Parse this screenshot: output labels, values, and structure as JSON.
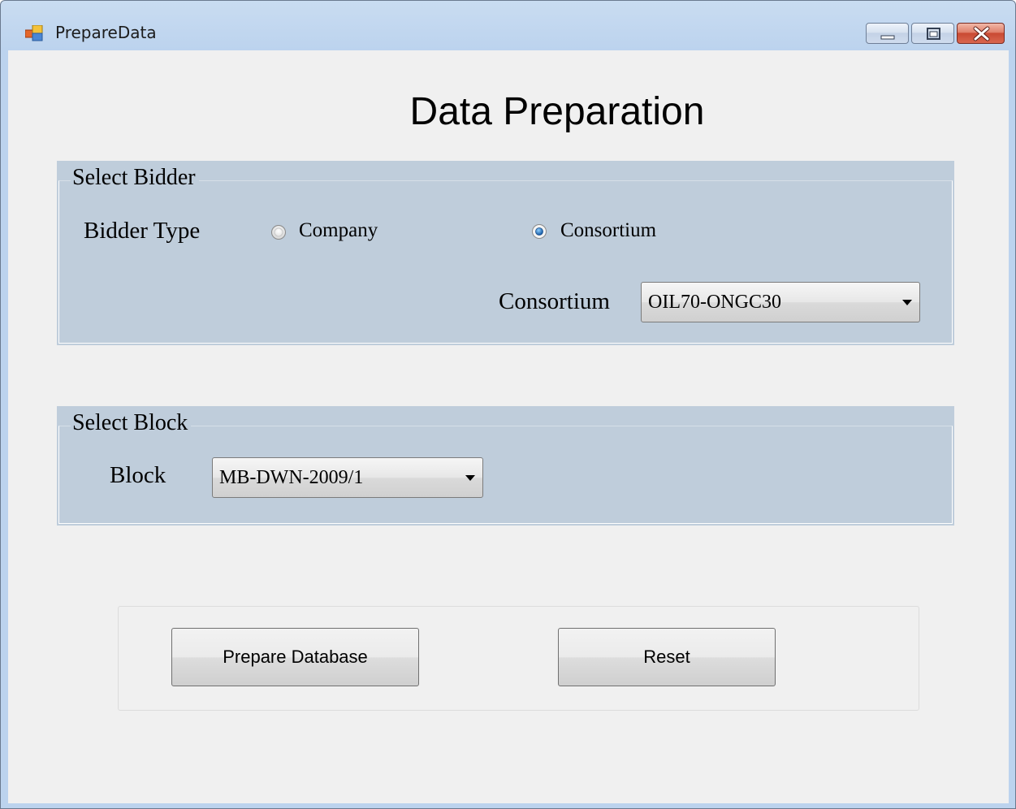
{
  "window": {
    "title": "PrepareData"
  },
  "heading": "Data Preparation",
  "select_bidder": {
    "legend": "Select Bidder",
    "bidder_type_label": "Bidder Type",
    "options": [
      {
        "label": "Company",
        "checked": false
      },
      {
        "label": "Consortium",
        "checked": true
      }
    ],
    "consortium_label": "Consortium",
    "consortium_value": "OIL70-ONGC30"
  },
  "select_block": {
    "legend": "Select Block",
    "block_label": "Block",
    "block_value": "MB-DWN-2009/1"
  },
  "actions": {
    "prepare_label": "Prepare Database",
    "reset_label": "Reset"
  },
  "icons": {
    "app": "app-window-icon",
    "minimize": "minimize-icon",
    "maximize": "maximize-icon",
    "close": "close-icon",
    "dropdown": "chevron-down-icon",
    "radio": "radio-icon"
  },
  "colors": {
    "group_background": "#bfcddb",
    "client_background": "#f0f0f0",
    "close_button": "#c94a33",
    "radio_selected": "#2a6db5"
  }
}
